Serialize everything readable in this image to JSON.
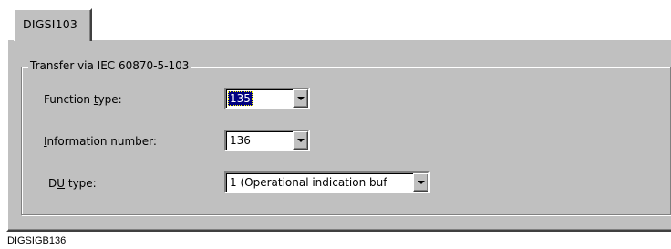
{
  "tab": {
    "label": "DIGSI103"
  },
  "group": {
    "title": "Transfer via IEC 60870-5-103"
  },
  "fields": {
    "function_type": {
      "label_pre": "Function ",
      "label_mnemonic": "t",
      "label_post": "ype:",
      "value": "135",
      "focused": true
    },
    "information_number": {
      "label_pre": "",
      "label_mnemonic": "I",
      "label_post": "nformation number:",
      "value": "136"
    },
    "du_type": {
      "label_pre": "D",
      "label_mnemonic": "U",
      "label_post": " type:",
      "value": "1 (Operational indication buf"
    }
  },
  "caption": "DIGSIGB136",
  "icons": {
    "dropdown": "chevron-down-icon"
  }
}
